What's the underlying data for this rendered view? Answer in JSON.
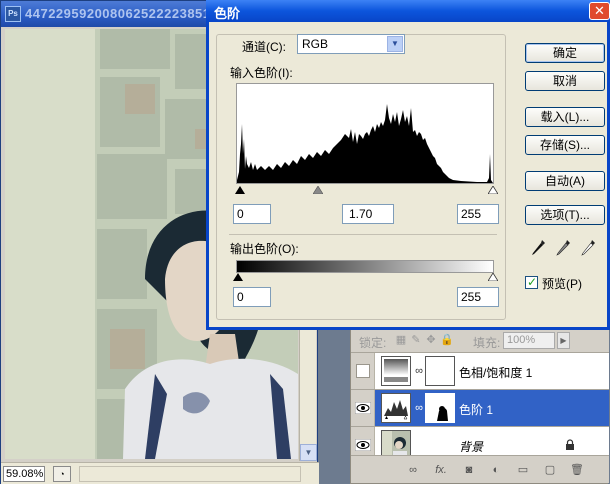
{
  "document": {
    "app_icon": "Ps",
    "title": "447229592008062522223851",
    "zoom": "59.08%"
  },
  "dialog": {
    "title": "色阶",
    "channel_label": "通道(C):",
    "channel_value": "RGB",
    "input_levels_label": "输入色阶(I):",
    "input_black": "0",
    "input_gamma": "1.70",
    "input_white": "255",
    "output_levels_label": "输出色阶(O):",
    "output_black": "0",
    "output_white": "255",
    "buttons": {
      "ok": "确定",
      "cancel": "取消",
      "load": "载入(L)...",
      "save": "存储(S)...",
      "auto": "自动(A)",
      "options": "选项(T)..."
    },
    "preview_label": "预览(P)",
    "preview_checked": true
  },
  "layers_panel": {
    "lock_label": "锁定:",
    "fill_label": "填充:",
    "fill_value": "100%",
    "layers": [
      {
        "name": "色相/饱和度 1",
        "visible": false,
        "selected": false
      },
      {
        "name": "色阶 1",
        "visible": true,
        "selected": true
      },
      {
        "name": "背景",
        "visible": true,
        "selected": false,
        "locked": true
      }
    ]
  },
  "colors": {
    "dialog_title_bar": "#0845c8",
    "selected_layer": "#3162c6"
  }
}
